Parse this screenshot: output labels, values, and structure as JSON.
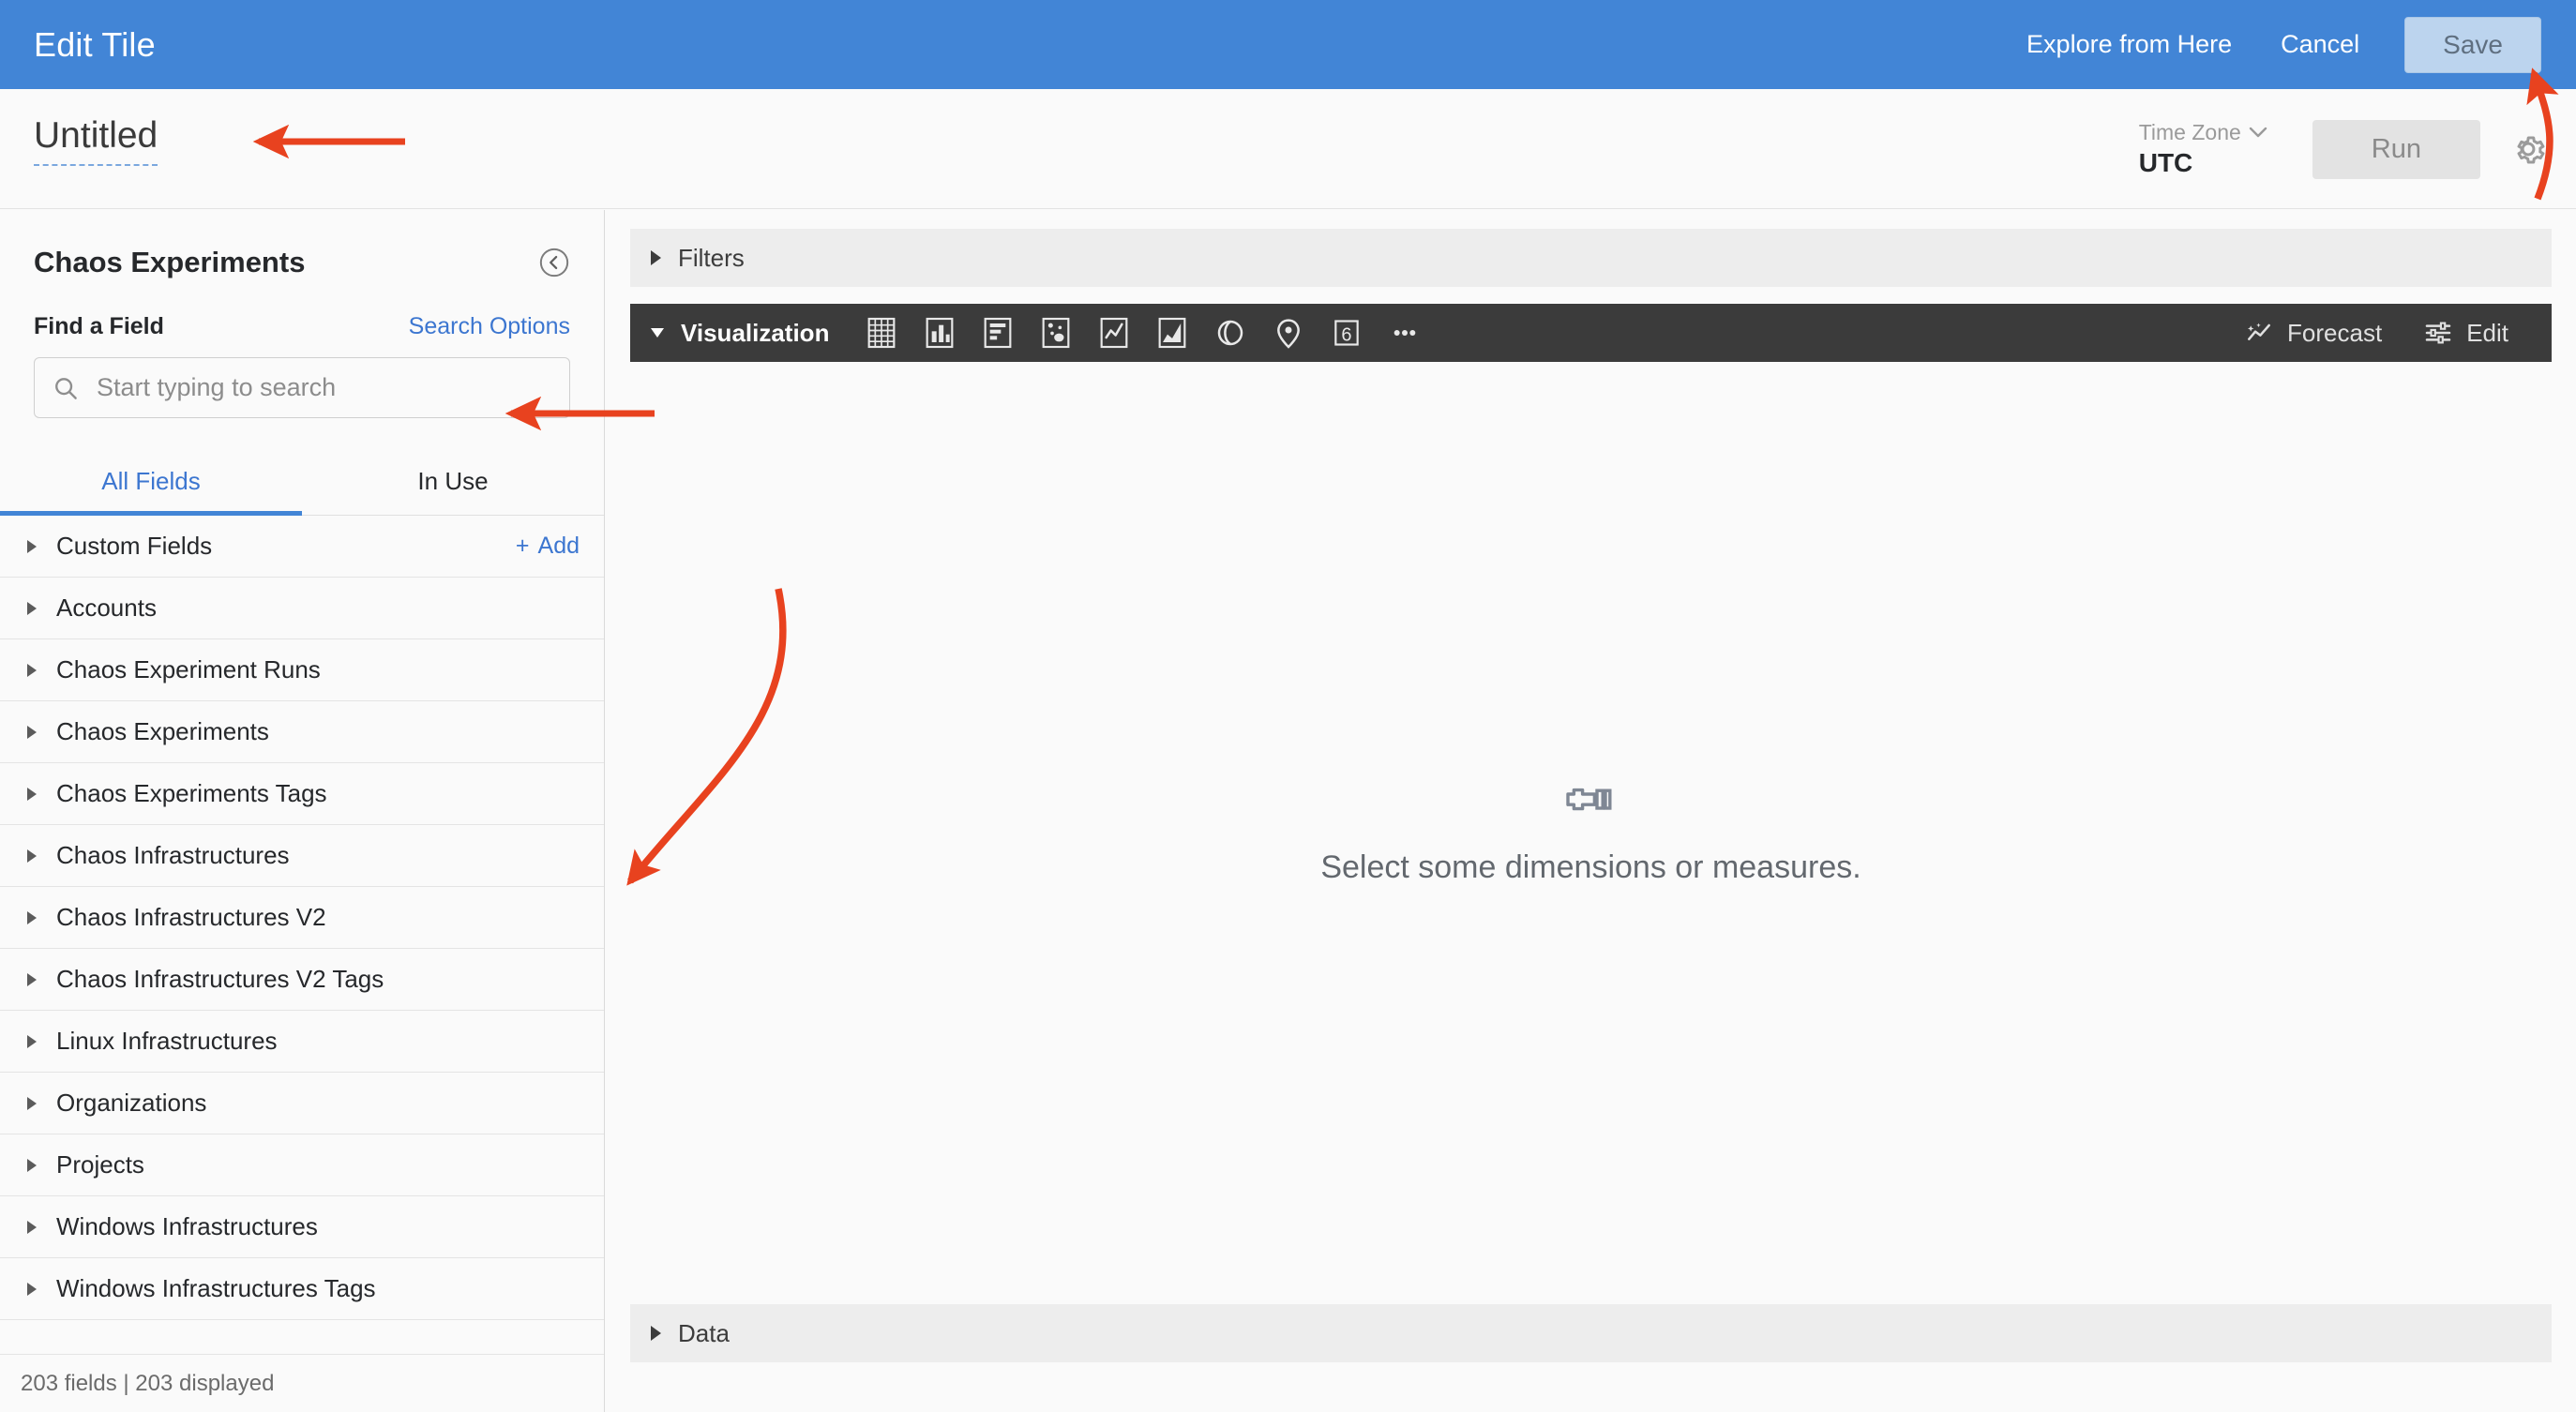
{
  "header": {
    "title": "Edit Tile",
    "explore_label": "Explore from Here",
    "cancel_label": "Cancel",
    "save_label": "Save",
    "background_color": "#4285d6"
  },
  "subheader": {
    "doc_title": "Untitled",
    "timezone_label": "Time Zone",
    "timezone_value": "UTC",
    "run_label": "Run",
    "gear_icon": "gear-icon"
  },
  "sidebar": {
    "title": "Chaos Experiments",
    "collapse_icon": "chevron-left-circle-icon",
    "find_label": "Find a Field",
    "search_options_label": "Search Options",
    "search_placeholder": "Start typing to search",
    "search_value": "",
    "search_icon": "search-icon",
    "tabs": [
      {
        "label": "All Fields",
        "active": true
      },
      {
        "label": "In Use",
        "active": false
      }
    ],
    "items": [
      {
        "label": "Custom Fields",
        "add_label": "Add",
        "has_add": true
      },
      {
        "label": "Accounts",
        "has_add": false
      },
      {
        "label": "Chaos Experiment Runs",
        "has_add": false
      },
      {
        "label": "Chaos Experiments",
        "has_add": false
      },
      {
        "label": "Chaos Experiments Tags",
        "has_add": false
      },
      {
        "label": "Chaos Infrastructures",
        "has_add": false
      },
      {
        "label": "Chaos Infrastructures V2",
        "has_add": false
      },
      {
        "label": "Chaos Infrastructures V2 Tags",
        "has_add": false
      },
      {
        "label": "Linux Infrastructures",
        "has_add": false
      },
      {
        "label": "Organizations",
        "has_add": false
      },
      {
        "label": "Projects",
        "has_add": false
      },
      {
        "label": "Windows Infrastructures",
        "has_add": false
      },
      {
        "label": "Windows Infrastructures Tags",
        "has_add": false
      }
    ],
    "footer": "203 fields | 203 displayed"
  },
  "main": {
    "filters_label": "Filters",
    "visualization_label": "Visualization",
    "viz_types": [
      {
        "name": "table-chart-icon",
        "title": "Table"
      },
      {
        "name": "column-chart-icon",
        "title": "Column"
      },
      {
        "name": "bar-chart-icon",
        "title": "Bar"
      },
      {
        "name": "scatter-chart-icon",
        "title": "Scatterplot"
      },
      {
        "name": "line-chart-icon",
        "title": "Line"
      },
      {
        "name": "area-chart-icon",
        "title": "Area"
      },
      {
        "name": "pie-chart-icon",
        "title": "Pie"
      },
      {
        "name": "map-pin-icon",
        "title": "Map"
      },
      {
        "name": "single-value-icon",
        "title": "Single Value",
        "glyph": "6"
      },
      {
        "name": "more-options-icon",
        "title": "More"
      }
    ],
    "forecast_label": "Forecast",
    "edit_label": "Edit",
    "empty_state_icon": "flashlight-icon",
    "empty_state_message": "Select some dimensions or measures.",
    "data_label": "Data"
  },
  "annotations": {
    "color": "#e8421f",
    "arrows": [
      {
        "name": "arrow-to-title",
        "type": "straight-left"
      },
      {
        "name": "arrow-to-search",
        "type": "straight-left"
      },
      {
        "name": "arrow-to-field-list",
        "type": "curved-down-left"
      },
      {
        "name": "arrow-to-save",
        "type": "curved-up"
      }
    ]
  }
}
